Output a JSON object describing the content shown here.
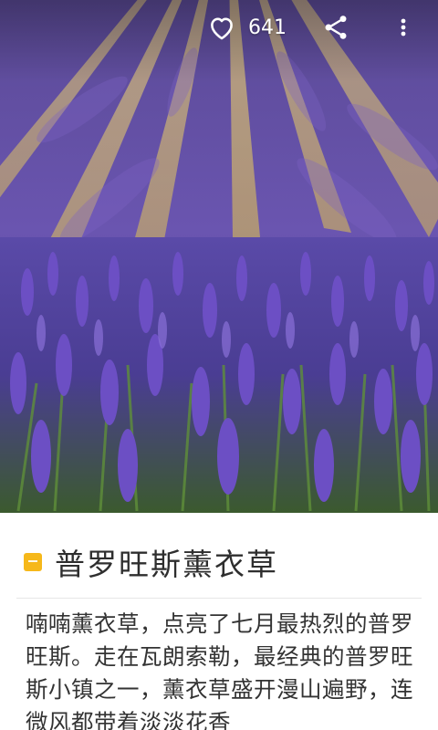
{
  "app": {
    "colors": {
      "accent": "#f6b81a",
      "title_text": "#2e2e2e",
      "body_text": "#333333",
      "overlay_icon": "#ffffff"
    }
  },
  "hero": {
    "icon": "lavender-field-photo"
  },
  "top_actions": {
    "like_icon": "heart-outline-icon",
    "like_count": "641",
    "share_icon": "share-icon",
    "more_icon": "more-vertical-icon"
  },
  "article": {
    "title_icon": "label-icon",
    "title": "普罗旺斯薰衣草",
    "body": "喃喃薰衣草，点亮了七月最热烈的普罗旺斯。走在瓦朗索勒，最经典的普罗旺斯小镇之一，薰衣草盛开漫山遍野，连微风都带着淡淡花香"
  }
}
